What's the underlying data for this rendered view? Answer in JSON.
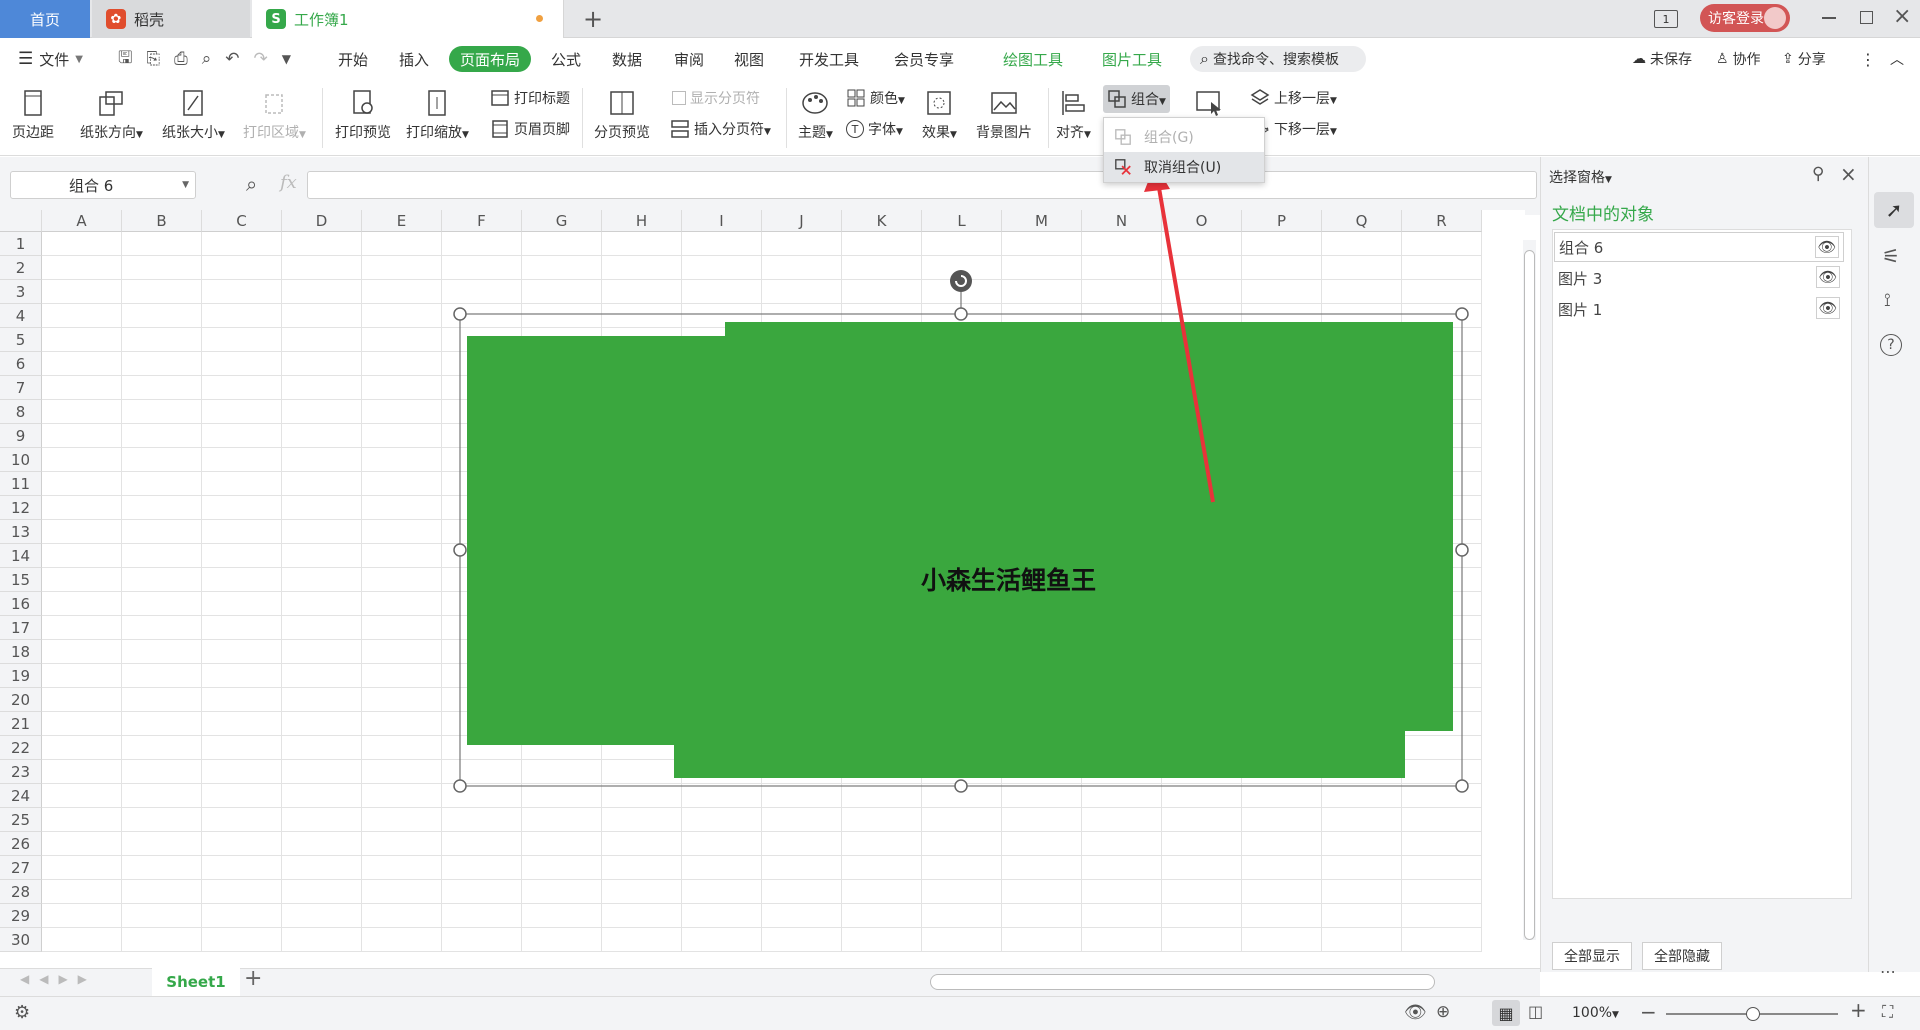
{
  "tabs": {
    "home": "首页",
    "daoke": "稻壳",
    "workbook": "工作簿1",
    "new_tab": "+"
  },
  "window": {
    "login": "访客登录"
  },
  "menu": {
    "file": "文件",
    "items": [
      "开始",
      "插入",
      "页面布局",
      "公式",
      "数据",
      "审阅",
      "视图",
      "开发工具",
      "会员专享",
      "绘图工具",
      "图片工具"
    ],
    "active": "页面布局",
    "search_placeholder": "查找命令、搜索模板",
    "unsaved": "未保存",
    "collab": "协作",
    "share": "分享"
  },
  "ribbon": {
    "margin": "页边距",
    "orientation": "纸张方向",
    "size": "纸张大小",
    "print_area": "打印区域",
    "print_preview": "打印预览",
    "print_scale": "打印缩放",
    "print_title": "打印标题",
    "header_footer": "页眉页脚",
    "page_break_preview": "分页预览",
    "show_page_breaks": "显示分页符",
    "insert_page_break": "插入分页符",
    "theme": "主题",
    "colors": "颜色",
    "fonts": "字体",
    "effects": "效果",
    "background_image": "背景图片",
    "align": "对齐",
    "group": "组合",
    "bring_forward": "上移一层",
    "send_backward": "下移一层"
  },
  "dropdown": {
    "group": "组合(G)",
    "ungroup": "取消组合(U)"
  },
  "namebox": "组合 6",
  "fx": "fx",
  "columns": [
    "A",
    "B",
    "C",
    "D",
    "E",
    "F",
    "G",
    "H",
    "I",
    "J",
    "K",
    "L",
    "M",
    "N",
    "O",
    "P",
    "Q",
    "R"
  ],
  "rows": [
    "1",
    "2",
    "3",
    "4",
    "5",
    "6",
    "7",
    "8",
    "9",
    "10",
    "11",
    "12",
    "13",
    "14",
    "15",
    "16",
    "17",
    "18",
    "19",
    "20",
    "21",
    "22",
    "23",
    "24",
    "25",
    "26",
    "27",
    "28",
    "29",
    "30"
  ],
  "shape": {
    "text": "小森生活鲤鱼王",
    "fill": "#3aa73e"
  },
  "panel": {
    "title": "选择窗格",
    "subtitle": "文档中的对象",
    "objects": [
      "组合 6",
      "图片 3",
      "图片 1"
    ],
    "show_all": "全部显示",
    "hide_all": "全部隐藏"
  },
  "sheet": {
    "name": "Sheet1",
    "add": "+"
  },
  "status": {
    "zoom": "100%"
  },
  "colors": {
    "accent": "#35a84a",
    "home_tab": "#4e88d8",
    "login": "#d25555",
    "arrow": "#e8323a"
  }
}
